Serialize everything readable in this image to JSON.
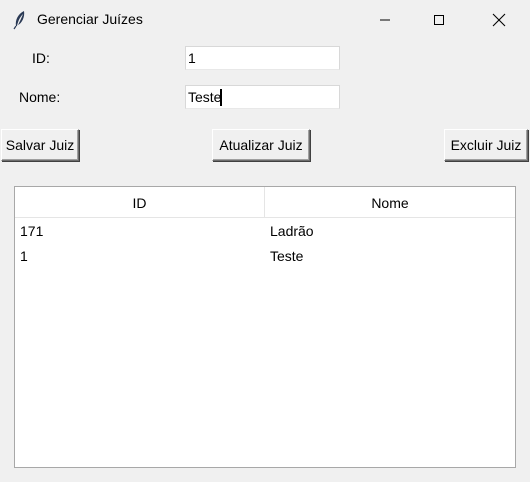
{
  "window": {
    "title": "Gerenciar Juízes",
    "icon": "feather-icon"
  },
  "form": {
    "id_label": "ID:",
    "id_value": "1",
    "nome_label": "Nome:",
    "nome_value": "Teste"
  },
  "buttons": {
    "save": "Salvar Juiz",
    "update": "Atualizar Juiz",
    "delete": "Excluir Juiz"
  },
  "table": {
    "columns": [
      "ID",
      "Nome"
    ],
    "rows": [
      {
        "id": "171",
        "nome": "Ladrão"
      },
      {
        "id": "1",
        "nome": "Teste"
      }
    ]
  }
}
